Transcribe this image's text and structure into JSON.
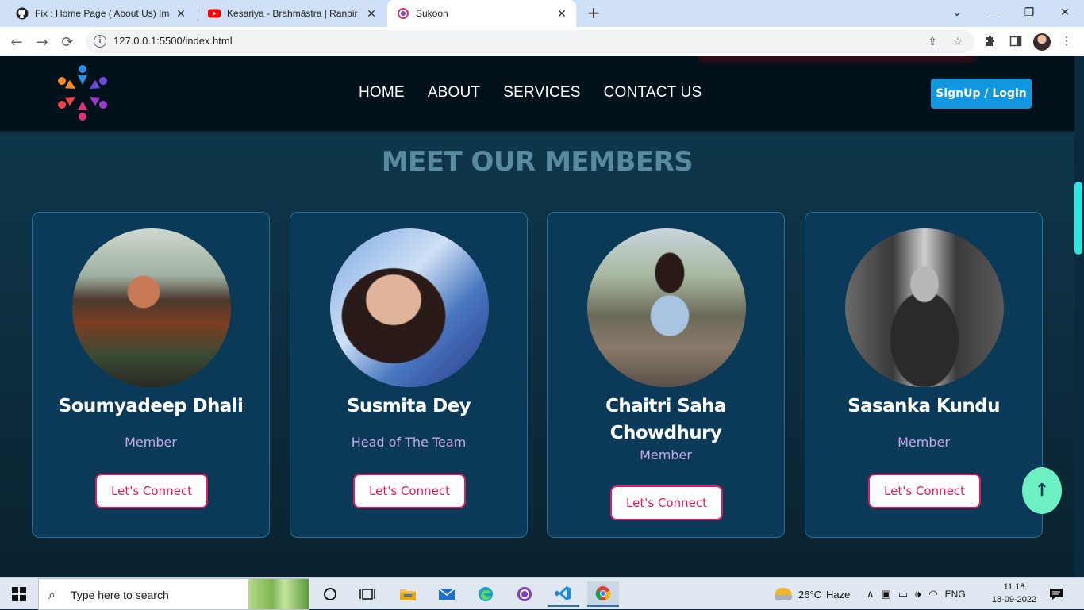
{
  "browser": {
    "tabs": [
      {
        "title": "Fix : Home Page ( About Us) Imag",
        "icon": "github-icon",
        "close": "✕"
      },
      {
        "title": "Kesariya - Brahmāstra | Ranbir Ka",
        "icon": "youtube-icon",
        "close": "✕"
      },
      {
        "title": "Sukoon",
        "icon": "sukoon-favicon",
        "close": "✕"
      }
    ],
    "new_tab": "+",
    "window_controls": {
      "dropdown": "⌄",
      "minimize": "—",
      "restore": "❐",
      "close": "✕"
    },
    "url": "127.0.0.1:5500/index.html"
  },
  "site": {
    "nav": {
      "items": [
        "HOME",
        "ABOUT",
        "SERVICES",
        "CONTACT US"
      ],
      "signup": "SignUp / Login"
    },
    "section_title": "MEET OUR MEMBERS",
    "members": [
      {
        "name": "Soumyadeep Dhali",
        "role": "Member",
        "button": "Let's Connect"
      },
      {
        "name": "Susmita Dey",
        "role": "Head of The Team",
        "button": "Let's Connect"
      },
      {
        "name": "Chaitri Saha Chowdhury",
        "role": "Member",
        "button": "Let's Connect"
      },
      {
        "name": "Sasanka Kundu",
        "role": "Member",
        "button": "Let's Connect"
      }
    ],
    "scroll_top_icon": "↑"
  },
  "taskbar": {
    "search_placeholder": "Type here to search",
    "weather": {
      "temp": "26°C",
      "condition": "Haze"
    },
    "language": "ENG",
    "time": "11:18",
    "date": "18-09-2022"
  },
  "colors": {
    "accent": "#1196e0",
    "connect": "#e6195e",
    "role": "#c9a8e6",
    "scroll_top": "#6ef0c3"
  }
}
